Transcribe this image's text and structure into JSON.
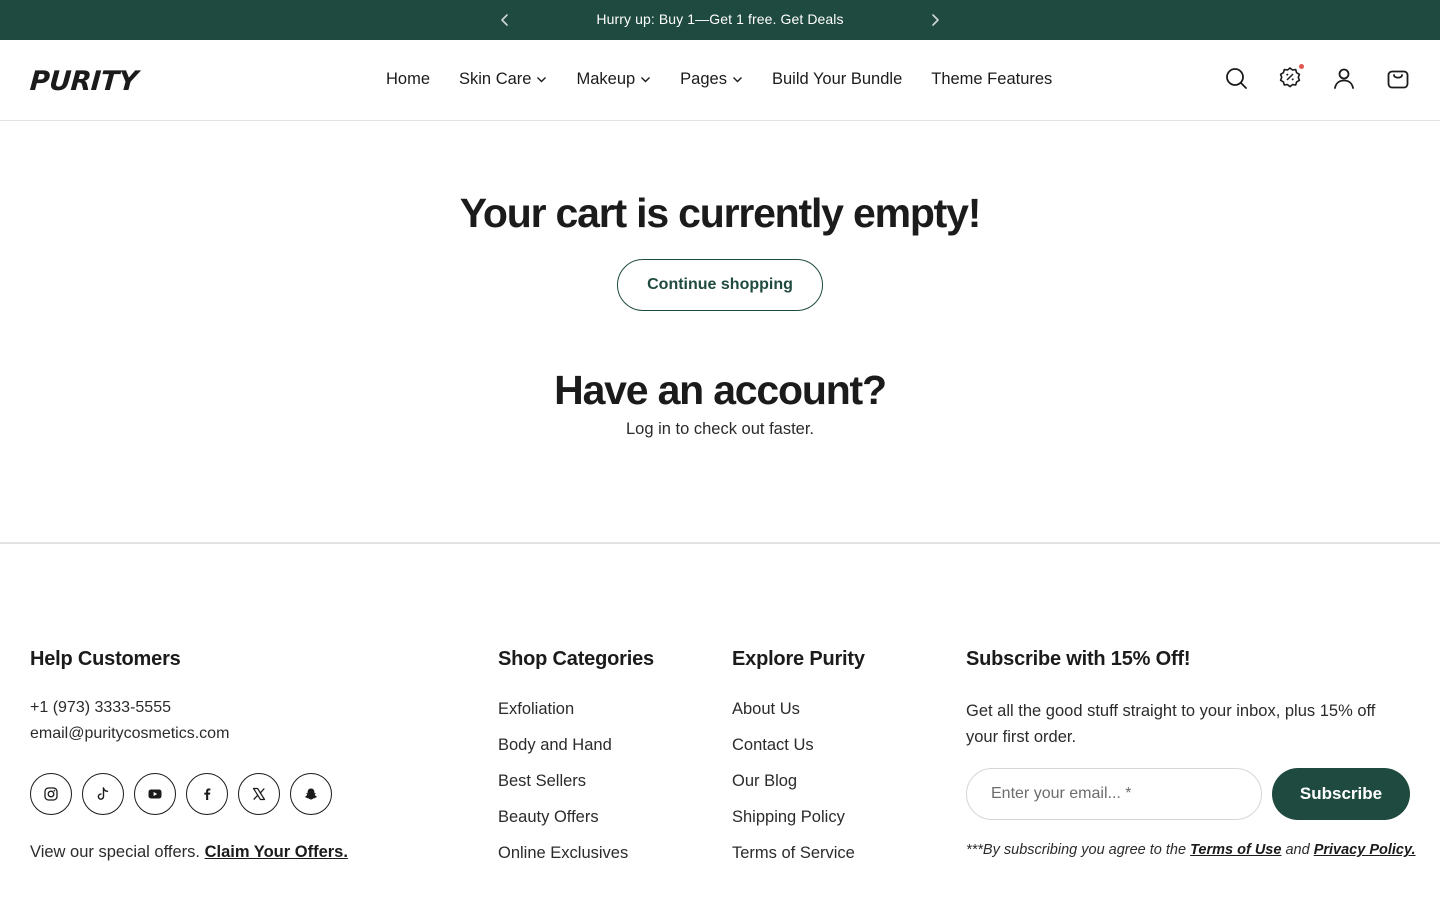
{
  "announcement": {
    "text": "Hurry up: Buy 1—Get 1 free. Get Deals",
    "prev_icon": "chevron-left-icon",
    "next_icon": "chevron-right-icon"
  },
  "header": {
    "logo": "PURITY",
    "nav": [
      {
        "label": "Home",
        "dropdown": false
      },
      {
        "label": "Skin Care",
        "dropdown": true
      },
      {
        "label": "Makeup",
        "dropdown": true
      },
      {
        "label": "Pages",
        "dropdown": true
      },
      {
        "label": "Build Your Bundle",
        "dropdown": false
      },
      {
        "label": "Theme Features",
        "dropdown": false
      }
    ],
    "icons": [
      "search-icon",
      "discount-badge-icon",
      "account-icon",
      "cart-icon"
    ]
  },
  "cart": {
    "empty_title": "Your cart is currently empty!",
    "continue_label": "Continue shopping",
    "account_title": "Have an account?",
    "account_sub": "Log in to check out faster."
  },
  "footer": {
    "help": {
      "heading": "Help Customers",
      "phone": "+1 (973) 3333-5555",
      "email": "email@puritycosmetics.com",
      "social": [
        "instagram-icon",
        "tiktok-icon",
        "youtube-icon",
        "facebook-icon",
        "x-icon",
        "snapchat-icon"
      ],
      "offer_text": "View our special offers.",
      "offer_link": "Claim Your Offers."
    },
    "shop": {
      "heading": "Shop Categories",
      "links": [
        "Exfoliation",
        "Body and Hand",
        "Best Sellers",
        "Beauty Offers",
        "Online Exclusives"
      ]
    },
    "explore": {
      "heading": "Explore Purity",
      "links": [
        "About Us",
        "Contact Us",
        "Our Blog",
        "Shipping Policy",
        "Terms of Service"
      ]
    },
    "subscribe": {
      "heading": "Subscribe with 15% Off!",
      "text": "Get all the good stuff straight to your inbox, plus 15% off your first order.",
      "placeholder": "Enter your email... *",
      "button": "Subscribe",
      "legal_prefix": "***By subscribing you agree to the",
      "terms": "Terms of Use",
      "and": "and",
      "privacy": "Privacy Policy."
    }
  },
  "colors": {
    "brand_green": "#1f4a3f",
    "notification_dot": "#e2554d"
  }
}
